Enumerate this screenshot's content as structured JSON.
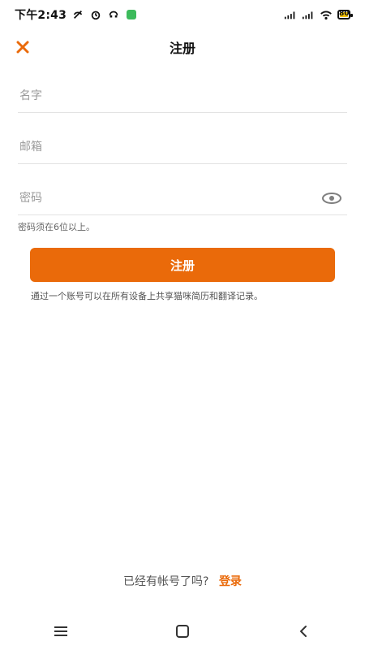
{
  "status_bar": {
    "time": "下午2:43",
    "battery_level": "80",
    "battery_level_fraction": 0.8,
    "icons": [
      "no-disturb-icon",
      "alarm-icon",
      "headphones-icon",
      "app-badge-icon",
      "signal-icon",
      "signal-icon",
      "wifi-icon",
      "battery-icon"
    ],
    "app_badge_color": "#3dbb5c"
  },
  "header": {
    "title": "注册",
    "close_icon": "close-icon",
    "accent_color": "#ea6a0a"
  },
  "form": {
    "name_placeholder": "名字",
    "email_placeholder": "邮箱",
    "password_placeholder": "密码",
    "password_hint": "密码须在6位以上。",
    "eye_icon": "eye-icon"
  },
  "register_button": {
    "label": "注册"
  },
  "note": "通过一个账号可以在所有设备上共享猫咪简历和翻译记录。",
  "login_prompt": {
    "text": "已经有帐号了吗?",
    "link": "登录"
  },
  "nav": {
    "menu_icon": "menu-icon",
    "home_icon": "home-icon",
    "back_icon": "back-icon"
  }
}
